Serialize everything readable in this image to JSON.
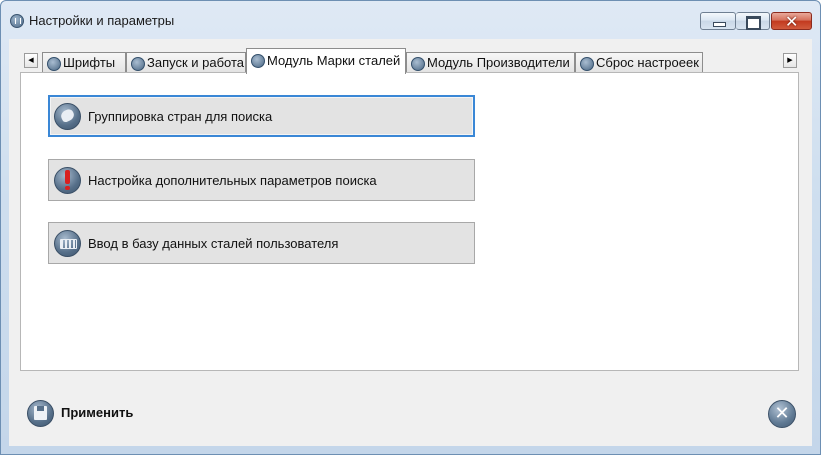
{
  "window": {
    "title": "Настройки и параметры",
    "controls": {
      "minimize": "minimize-icon",
      "maximize": "maximize-icon",
      "close": "close-icon"
    }
  },
  "tabs": [
    {
      "label": "Шрифты",
      "icon": "fonts-icon",
      "active": false
    },
    {
      "label": "Запуск и работа",
      "icon": "startup-icon",
      "active": false
    },
    {
      "label": "Модуль Марки сталей",
      "icon": "steel-module-icon",
      "active": true
    },
    {
      "label": "Модуль Производители",
      "icon": "manufacturers-icon",
      "active": false
    },
    {
      "label": "Сброс настроеек",
      "icon": "reset-icon",
      "active": false
    }
  ],
  "panel": {
    "buttons": [
      {
        "label": "Группировка стран для поиска",
        "icon": "globe-icon"
      },
      {
        "label": "Настройка дополнительных параметров поиска",
        "icon": "warning-icon"
      },
      {
        "label": "Ввод в базу данных сталей пользователя",
        "icon": "keyboard-icon"
      }
    ]
  },
  "footer": {
    "apply_label": "Применить",
    "apply_icon": "save-icon",
    "close_icon": "close-circle-icon"
  },
  "colors": {
    "focus_border": "#3a87d6",
    "close_button": "#c2391f",
    "icon_blue": "#566f89"
  }
}
